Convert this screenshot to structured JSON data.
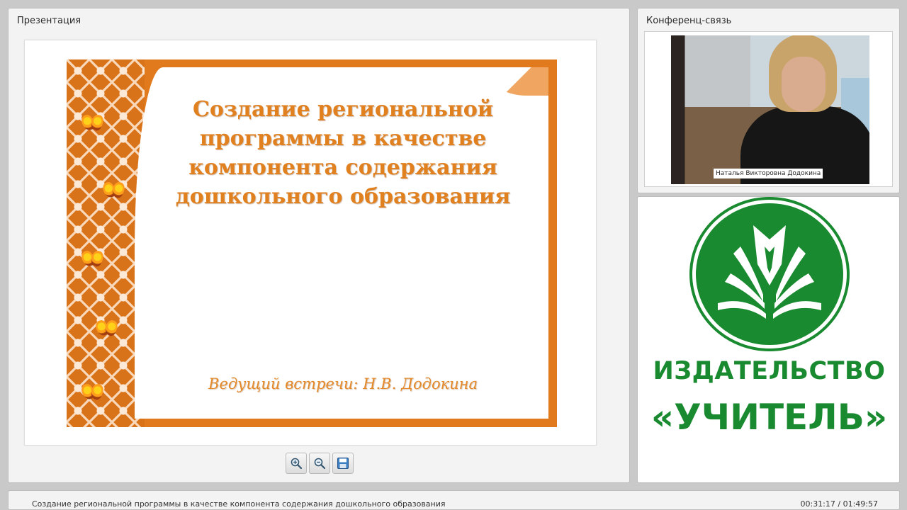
{
  "presentation_panel": {
    "title": "Презентация",
    "slide": {
      "title": "Создание региональной программы в качестве компонента содержания дошкольного образования",
      "presenter": "Ведущий встречи: Н.В. Додокина"
    },
    "toolbar": {
      "zoom_in_icon": "zoom-in-icon",
      "zoom_out_icon": "zoom-out-icon",
      "save_icon": "floppy-disk-icon"
    }
  },
  "conference_panel": {
    "title": "Конференц-связь",
    "participant_name": "Наталья Викторовна Додокина"
  },
  "logo_panel": {
    "line1": "ИЗДАТЕЛЬСТВО",
    "line2": "«УЧИТЕЛЬ»",
    "brand_color": "#198a2f"
  },
  "status_bar": {
    "title": "Создание региональной программы в качестве компонента содержания дошкольного образования",
    "time": "00:31:17 / 01:49:57"
  },
  "colors": {
    "slide_orange": "#e07a1c",
    "slide_text": "#e0801f",
    "panel_bg": "#f3f3f3"
  }
}
